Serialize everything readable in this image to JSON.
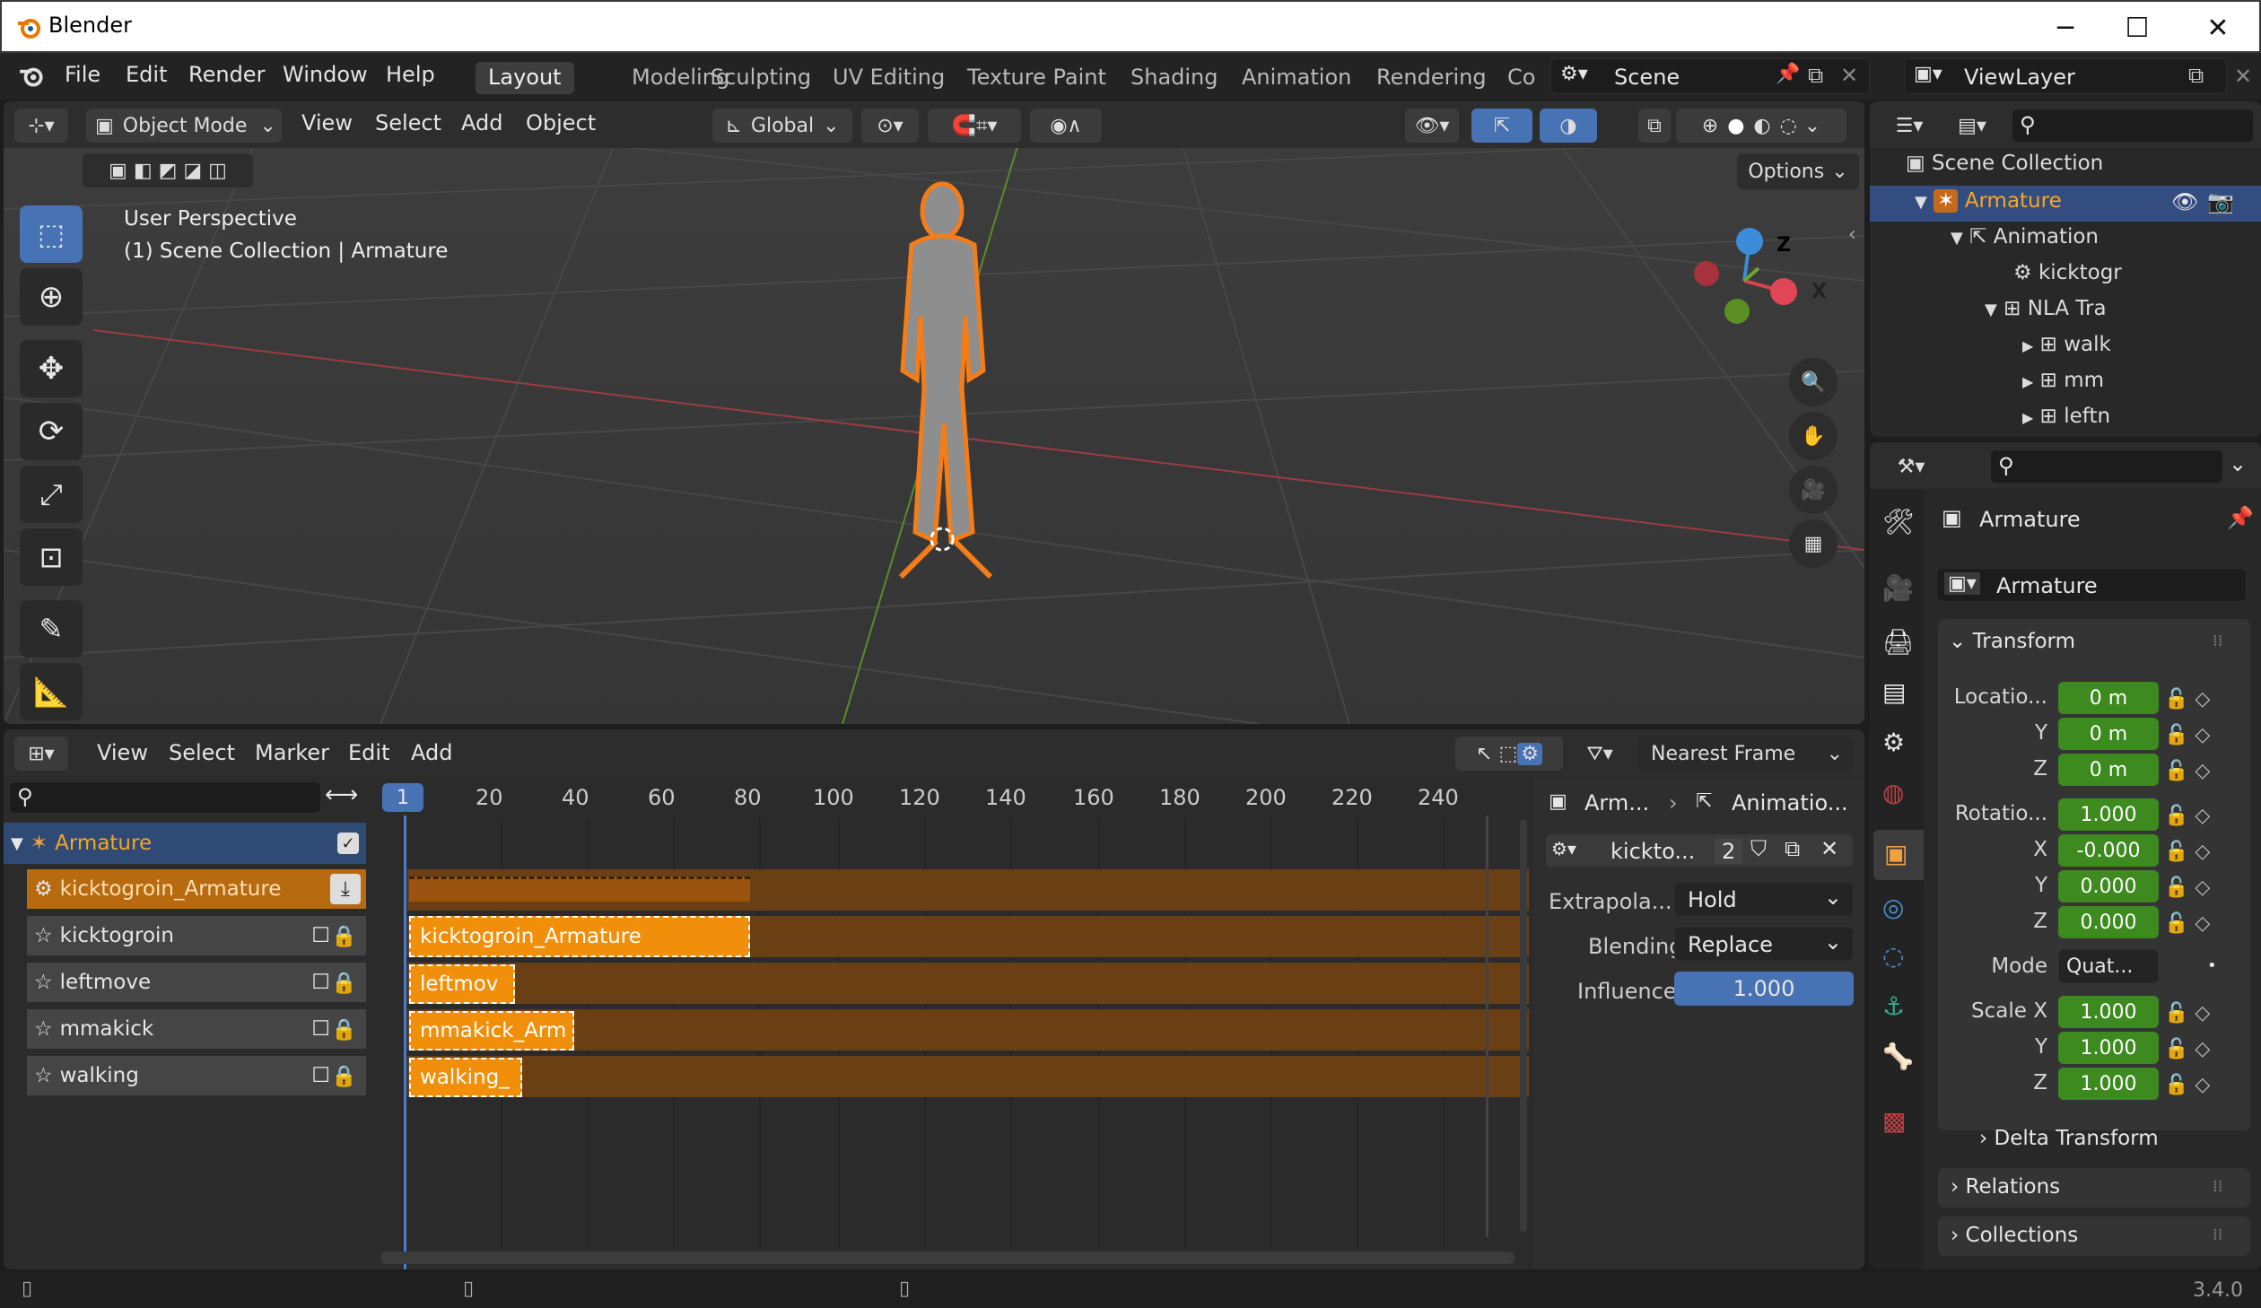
{
  "app": {
    "title": "Blender",
    "version": "3.4.0"
  },
  "menu": [
    "File",
    "Edit",
    "Render",
    "Window",
    "Help"
  ],
  "workspaces": [
    "Layout",
    "Modeling",
    "Sculpting",
    "UV Editing",
    "Texture Paint",
    "Shading",
    "Animation",
    "Rendering",
    "Co"
  ],
  "active_workspace": "Layout",
  "scene": {
    "name": "Scene",
    "view_layer": "ViewLayer"
  },
  "viewport": {
    "mode": "Object Mode",
    "menus": [
      "View",
      "Select",
      "Add",
      "Object"
    ],
    "orientation": "Global",
    "options_label": "Options",
    "overlay_line1": "User Perspective",
    "overlay_line2": "(1) Scene Collection | Armature",
    "gizmo": {
      "z": "Z",
      "x": "X"
    }
  },
  "nla": {
    "menus": [
      "View",
      "Select",
      "Marker",
      "Edit",
      "Add"
    ],
    "snap": "Nearest Frame",
    "current_frame": "1",
    "ruler": [
      "20",
      "40",
      "60",
      "80",
      "100",
      "120",
      "140",
      "160",
      "180",
      "200",
      "220",
      "240"
    ],
    "object": "Armature",
    "action_track": "kicktogroin_Armature",
    "tracks": [
      {
        "name": "kicktogroin",
        "strip": "kicktogroin_Armature"
      },
      {
        "name": "leftmove",
        "strip": "leftmov"
      },
      {
        "name": "mmakick",
        "strip": "mmakick_Arm"
      },
      {
        "name": "walking",
        "strip": "walking_"
      }
    ],
    "sidebar": {
      "breadcrumb_obj": "Arm...",
      "breadcrumb_anim": "Animatio...",
      "action_name": "kickto...",
      "users": "2",
      "extrapolation_label": "Extrapola...",
      "extrapolation_value": "Hold",
      "blending_label": "Blending",
      "blending_value": "Replace",
      "influence_label": "Influence",
      "influence_value": "1.000"
    }
  },
  "outliner": {
    "items": [
      {
        "label": "Scene Collection"
      },
      {
        "label": "Armature"
      },
      {
        "label": "Animation"
      },
      {
        "label": "kicktogr"
      },
      {
        "label": "NLA Tra"
      },
      {
        "label": "walk"
      },
      {
        "label": "mm"
      },
      {
        "label": "leftn"
      }
    ]
  },
  "properties": {
    "object_header": "Armature",
    "object_name": "Armature",
    "transform_label": "Transform",
    "location_label": "Locatio...",
    "location": [
      "0 m",
      "0 m",
      "0 m"
    ],
    "rotation_label": "Rotatio...",
    "rotation": [
      "1.000",
      "-0.000",
      "0.000",
      "0.000"
    ],
    "mode_label": "Mode",
    "mode_value": "Quat...",
    "scale_label": "Scale X",
    "scale": [
      "1.000",
      "1.000",
      "1.000"
    ],
    "axis_y": "Y",
    "axis_z": "Z",
    "axis_x": "X",
    "delta_transform": "Delta Transform",
    "relations": "Relations",
    "collections": "Collections"
  }
}
